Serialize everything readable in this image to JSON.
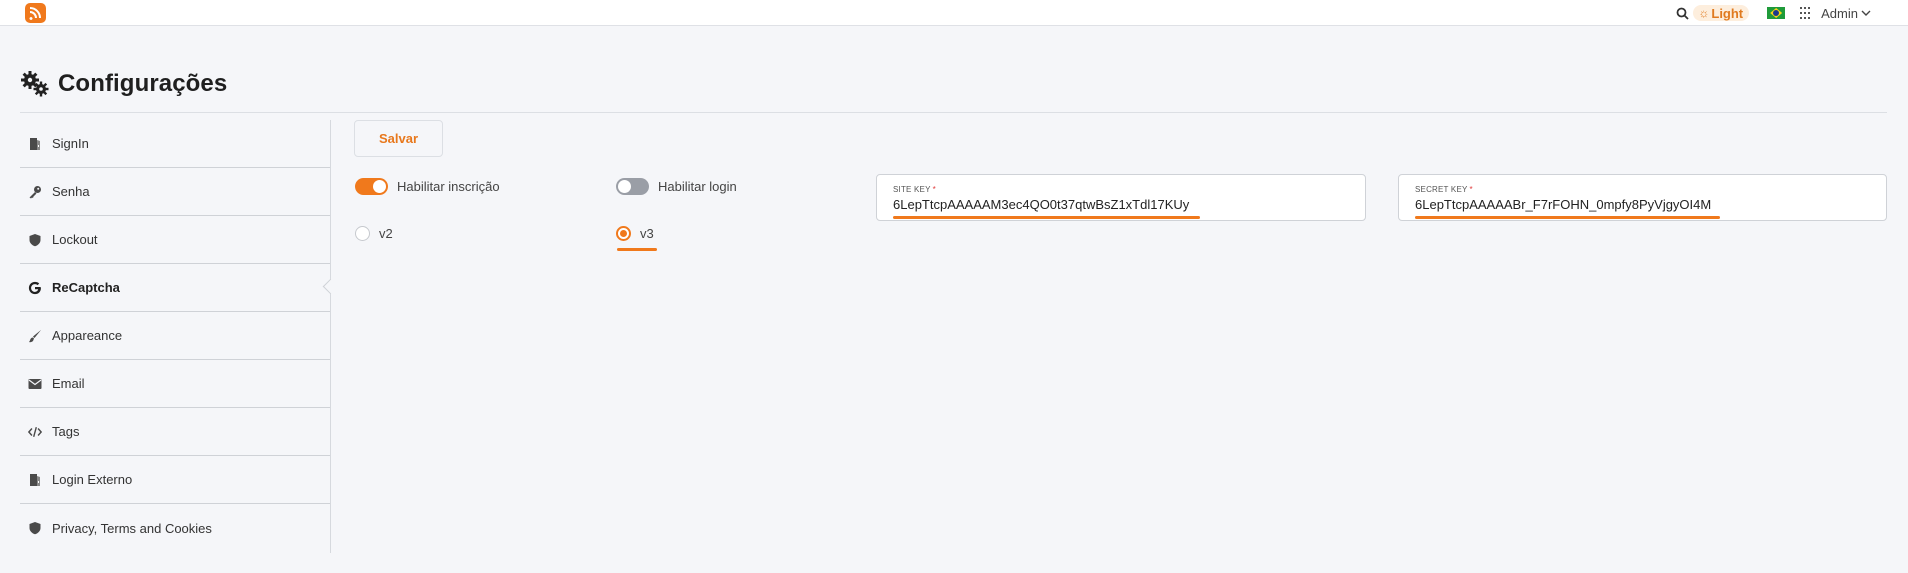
{
  "topbar": {
    "logo_icon": "app-logo-icon",
    "search_icon": "search-icon",
    "theme_label": "Light",
    "theme_icon": "sun-icon",
    "language_flag": "brazil-flag-icon",
    "apps_icon": "apps-grid-icon",
    "user_label": "Admin"
  },
  "page": {
    "title": "Configurações",
    "title_icon": "gears-icon"
  },
  "sidebar": {
    "items": [
      {
        "label": "SignIn",
        "icon": "signin-door-icon"
      },
      {
        "label": "Senha",
        "icon": "key-icon"
      },
      {
        "label": "Lockout",
        "icon": "shield-icon"
      },
      {
        "label": "ReCaptcha",
        "icon": "google-icon",
        "active": true
      },
      {
        "label": "Appareance",
        "icon": "brush-icon"
      },
      {
        "label": "Email",
        "icon": "envelope-icon"
      },
      {
        "label": "Tags",
        "icon": "code-icon"
      },
      {
        "label": "Login Externo",
        "icon": "signin-door-icon"
      },
      {
        "label": "Privacy, Terms and Cookies",
        "icon": "shield-icon"
      }
    ]
  },
  "main": {
    "save_label": "Salvar",
    "toggles": [
      {
        "label": "Habilitar inscrição",
        "on": true
      },
      {
        "label": "Habilitar login",
        "on": false
      }
    ],
    "radios": [
      {
        "label": "v2",
        "checked": false
      },
      {
        "label": "v3",
        "checked": true
      }
    ],
    "fields": [
      {
        "label": "SITE KEY",
        "required": "*",
        "value": "6LepTtcpAAAAAM3ec4QO0t37qtwBsZ1xTdl17KUy"
      },
      {
        "label": "SECRET KEY",
        "required": "*",
        "value": "6LepTtcpAAAAABr_F7rFOHN_0mpfy8PyVjgyOI4M"
      }
    ]
  },
  "colors": {
    "accent": "#f0791c",
    "background": "#f5f6f9"
  }
}
